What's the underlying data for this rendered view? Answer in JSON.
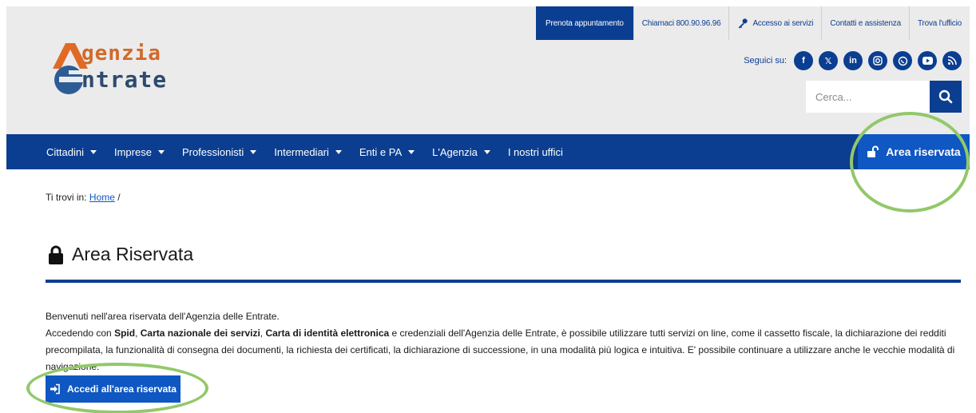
{
  "toplinks": [
    {
      "label": "Prenota appuntamento"
    },
    {
      "label": "Chiamaci 800.90.96.96"
    },
    {
      "label": "Accesso ai servizi"
    },
    {
      "label": "Contatti e assistenza"
    },
    {
      "label": "Trova l'ufficio"
    }
  ],
  "logo": {
    "line1": "genzia",
    "line2": "ntrate"
  },
  "social": {
    "label": "Seguici su:",
    "icons": [
      "facebook-icon",
      "x-icon",
      "linkedin-icon",
      "instagram-icon",
      "whatsapp-icon",
      "youtube-icon",
      "rss-icon"
    ]
  },
  "search": {
    "placeholder": "Cerca..."
  },
  "nav": {
    "items": [
      {
        "label": "Cittadini"
      },
      {
        "label": "Imprese"
      },
      {
        "label": "Professionisti"
      },
      {
        "label": "Intermediari"
      },
      {
        "label": "Enti e PA"
      },
      {
        "label": "L'Agenzia"
      },
      {
        "label": "I nostri uffici"
      }
    ],
    "area_riservata": "Area riservata"
  },
  "breadcrumb": {
    "prefix": "Ti trovi in:",
    "home": "Home",
    "sep": "/"
  },
  "page": {
    "title": "Area Riservata",
    "intro_line1": "Benvenuti nell'area riservata dell'Agenzia delle Entrate.",
    "intro_p1": "Accedendo con ",
    "spid": "Spid",
    "comma1": ", ",
    "cns": "Carta nazionale dei servizi",
    "comma2": ", ",
    "cie": "Carta di identità elettronica",
    "intro_p2": " e credenziali dell'Agenzia delle Entrate, è possibile utilizzare tutti servizi on line, come il cassetto fiscale, la dichiarazione dei redditi precompilata, la funzionalità di consegna dei documenti, la richiesta dei certificati, la dichiarazione di successione, in una modalità più logica e intuitiva. E' possibile continuare a utilizzare anche le vecchie modalità di navigazione.",
    "cta": "Accedi all'area riservata"
  },
  "colors": {
    "brand_blue": "#0b3e91",
    "button_blue": "#0f57c2",
    "highlight_green": "#92c86a",
    "header_gray": "#ebebeb"
  }
}
